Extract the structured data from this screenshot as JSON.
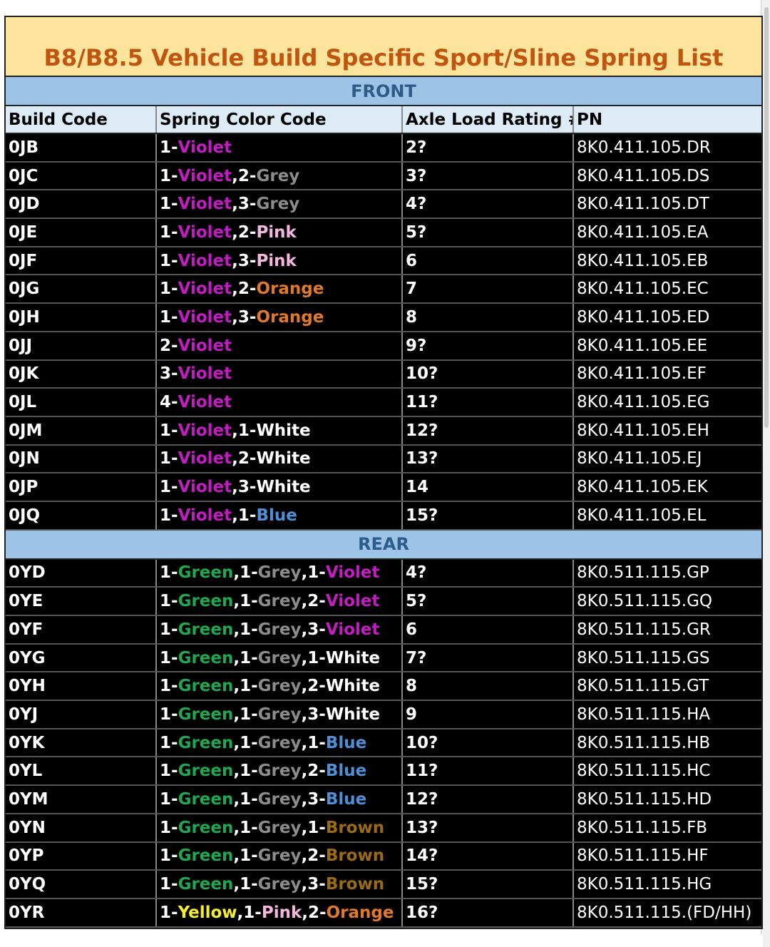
{
  "title": "B8/B8.5 Vehicle Build Specific Sport/Sline Spring List",
  "colors": {
    "title_bg": "#fde49c",
    "title_text": "#c0550f",
    "section_bg": "#9dc3e6",
    "section_text": "#2e5c8a",
    "header_bg": "#ddebf7",
    "Violet": "#c21cc2",
    "Grey": "#8c8c8c",
    "Pink": "#f4b7df",
    "Orange": "#e07a2a",
    "White": "#ffffff",
    "Blue": "#4f8fd6",
    "Green": "#1fa84f",
    "Brown": "#9a6b12",
    "Yellow": "#f7ee2c",
    "Default": "#ffffff"
  },
  "headers": [
    "Build Code",
    "Spring Color Code",
    "Axle Load Rating #",
    "PN"
  ],
  "front": {
    "label": "FRONT",
    "rows": [
      {
        "code": "0JB",
        "springs": [
          {
            "n": "1",
            "color": "Violet"
          }
        ],
        "rating": "2?",
        "pn": "8K0.411.105.DR"
      },
      {
        "code": "0JC",
        "springs": [
          {
            "n": "1",
            "color": "Violet"
          },
          {
            "n": "2",
            "color": "Grey"
          }
        ],
        "rating": "3?",
        "pn": "8K0.411.105.DS"
      },
      {
        "code": "0JD",
        "springs": [
          {
            "n": "1",
            "color": "Violet"
          },
          {
            "n": "3",
            "color": "Grey"
          }
        ],
        "rating": "4?",
        "pn": "8K0.411.105.DT"
      },
      {
        "code": "0JE",
        "springs": [
          {
            "n": "1",
            "color": "Violet"
          },
          {
            "n": "2",
            "color": "Pink"
          }
        ],
        "rating": "5?",
        "pn": "8K0.411.105.EA"
      },
      {
        "code": "0JF",
        "springs": [
          {
            "n": "1",
            "color": "Violet"
          },
          {
            "n": "3",
            "color": "Pink"
          }
        ],
        "rating": "6",
        "pn": "8K0.411.105.EB"
      },
      {
        "code": "0JG",
        "springs": [
          {
            "n": "1",
            "color": "Violet"
          },
          {
            "n": "2",
            "color": "Orange"
          }
        ],
        "rating": "7",
        "pn": "8K0.411.105.EC"
      },
      {
        "code": "0JH",
        "springs": [
          {
            "n": "1",
            "color": "Violet"
          },
          {
            "n": "3",
            "color": "Orange"
          }
        ],
        "rating": "8",
        "pn": "8K0.411.105.ED"
      },
      {
        "code": "0JJ",
        "springs": [
          {
            "n": "2",
            "color": "Violet"
          }
        ],
        "rating": "9?",
        "pn": "8K0.411.105.EE"
      },
      {
        "code": "0JK",
        "springs": [
          {
            "n": "3",
            "color": "Violet"
          }
        ],
        "rating": "10?",
        "pn": "8K0.411.105.EF"
      },
      {
        "code": "0JL",
        "springs": [
          {
            "n": "4",
            "color": "Violet"
          }
        ],
        "rating": "11?",
        "pn": "8K0.411.105.EG"
      },
      {
        "code": "0JM",
        "springs": [
          {
            "n": "1",
            "color": "Violet"
          },
          {
            "n": "1",
            "color": "White"
          }
        ],
        "rating": "12?",
        "pn": "8K0.411.105.EH"
      },
      {
        "code": "0JN",
        "springs": [
          {
            "n": "1",
            "color": "Violet"
          },
          {
            "n": "2",
            "color": "White"
          }
        ],
        "rating": "13?",
        "pn": "8K0.411.105.EJ"
      },
      {
        "code": "0JP",
        "springs": [
          {
            "n": "1",
            "color": "Violet"
          },
          {
            "n": "3",
            "color": "White"
          }
        ],
        "rating": "14",
        "pn": "8K0.411.105.EK"
      },
      {
        "code": "0JQ",
        "springs": [
          {
            "n": "1",
            "color": "Violet"
          },
          {
            "n": "1",
            "color": "Blue"
          }
        ],
        "rating": "15?",
        "pn": "8K0.411.105.EL"
      }
    ]
  },
  "rear": {
    "label": "REAR",
    "rows": [
      {
        "code": "0YD",
        "springs": [
          {
            "n": "1",
            "color": "Green"
          },
          {
            "n": "1",
            "color": "Grey"
          },
          {
            "n": "1",
            "color": "Violet"
          }
        ],
        "rating": "4?",
        "pn": "8K0.511.115.GP"
      },
      {
        "code": "0YE",
        "springs": [
          {
            "n": "1",
            "color": "Green"
          },
          {
            "n": "1",
            "color": "Grey"
          },
          {
            "n": "2",
            "color": "Violet"
          }
        ],
        "rating": "5?",
        "pn": "8K0.511.115.GQ"
      },
      {
        "code": "0YF",
        "springs": [
          {
            "n": "1",
            "color": "Green"
          },
          {
            "n": "1",
            "color": "Grey"
          },
          {
            "n": "3",
            "color": "Violet"
          }
        ],
        "rating": "6",
        "pn": "8K0.511.115.GR"
      },
      {
        "code": "0YG",
        "springs": [
          {
            "n": "1",
            "color": "Green"
          },
          {
            "n": "1",
            "color": "Grey"
          },
          {
            "n": "1",
            "color": "White"
          }
        ],
        "rating": "7?",
        "pn": "8K0.511.115.GS"
      },
      {
        "code": "0YH",
        "springs": [
          {
            "n": "1",
            "color": "Green"
          },
          {
            "n": "1",
            "color": "Grey"
          },
          {
            "n": "2",
            "color": "White"
          }
        ],
        "rating": "8",
        "pn": "8K0.511.115.GT"
      },
      {
        "code": "0YJ",
        "springs": [
          {
            "n": "1",
            "color": "Green"
          },
          {
            "n": "1",
            "color": "Grey"
          },
          {
            "n": "3",
            "color": "White"
          }
        ],
        "rating": "9",
        "pn": "8K0.511.115.HA"
      },
      {
        "code": "0YK",
        "springs": [
          {
            "n": "1",
            "color": "Green"
          },
          {
            "n": "1",
            "color": "Grey"
          },
          {
            "n": "1",
            "color": "Blue"
          }
        ],
        "rating": "10?",
        "pn": "8K0.511.115.HB"
      },
      {
        "code": "0YL",
        "springs": [
          {
            "n": "1",
            "color": "Green"
          },
          {
            "n": "1",
            "color": "Grey"
          },
          {
            "n": "2",
            "color": "Blue"
          }
        ],
        "rating": "11?",
        "pn": "8K0.511.115.HC"
      },
      {
        "code": "0YM",
        "springs": [
          {
            "n": "1",
            "color": "Green"
          },
          {
            "n": "1",
            "color": "Grey"
          },
          {
            "n": "3",
            "color": "Blue"
          }
        ],
        "rating": "12?",
        "pn": "8K0.511.115.HD"
      },
      {
        "code": "0YN",
        "springs": [
          {
            "n": "1",
            "color": "Green"
          },
          {
            "n": "1",
            "color": "Grey"
          },
          {
            "n": "1",
            "color": "Brown"
          }
        ],
        "rating": "13?",
        "pn": "8K0.511.115.FB"
      },
      {
        "code": "0YP",
        "springs": [
          {
            "n": "1",
            "color": "Green"
          },
          {
            "n": "1",
            "color": "Grey"
          },
          {
            "n": "2",
            "color": "Brown"
          }
        ],
        "rating": "14?",
        "pn": "8K0.511.115.HF"
      },
      {
        "code": "0YQ",
        "springs": [
          {
            "n": "1",
            "color": "Green"
          },
          {
            "n": "1",
            "color": "Grey"
          },
          {
            "n": "3",
            "color": "Brown"
          }
        ],
        "rating": "15?",
        "pn": "8K0.511.115.HG"
      },
      {
        "code": "0YR",
        "springs": [
          {
            "n": "1",
            "color": "Yellow"
          },
          {
            "n": "1",
            "color": "Pink"
          },
          {
            "n": "2",
            "color": "Orange"
          }
        ],
        "rating": "16?",
        "pn": "8K0.511.115.(FD/HH)"
      }
    ]
  }
}
